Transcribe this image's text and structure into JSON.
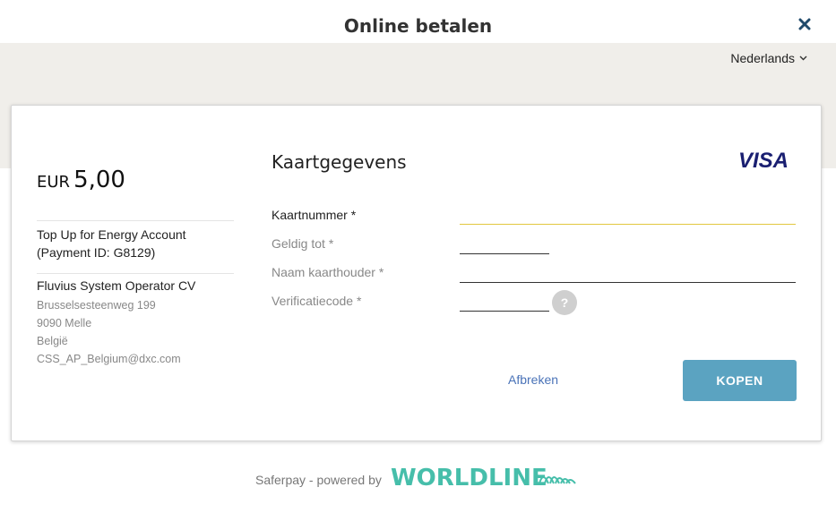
{
  "header": {
    "title": "Online betalen",
    "close_icon": "close-icon"
  },
  "language": {
    "selected": "Nederlands",
    "icon": "chevron-down-icon"
  },
  "summary": {
    "currency": "EUR",
    "amount": "5,00",
    "description_line1": "Top Up for Energy Account",
    "description_line2": "(Payment ID: G8129)",
    "merchant_name": "Fluvius System Operator CV",
    "address": [
      "Brusselsesteenweg 199",
      "9090 Melle",
      "België",
      "CSS_AP_Belgium@dxc.com"
    ]
  },
  "form": {
    "title": "Kaartgegevens",
    "card_brand": "VISA",
    "fields": {
      "card_number": {
        "label": "Kaartnummer *",
        "value": ""
      },
      "expiry": {
        "label": "Geldig tot *",
        "value": ""
      },
      "holder": {
        "label": "Naam kaarthouder *",
        "value": ""
      },
      "cvc": {
        "label": "Verificatiecode *",
        "value": ""
      }
    },
    "help_label": "?",
    "cancel_label": "Afbreken",
    "buy_label": "KOPEN"
  },
  "footer": {
    "powered_by": "Saferpay - powered by",
    "brand_logo_text": "WORLDLINE"
  },
  "colors": {
    "brand_band": "#f0eeea",
    "button": "#5ba3c1",
    "link": "#4a73b8",
    "focus_underline": "#e2c73f",
    "close_icon": "#1f4a6b",
    "visa": "#1a1f71",
    "worldline": "#46beaa"
  }
}
